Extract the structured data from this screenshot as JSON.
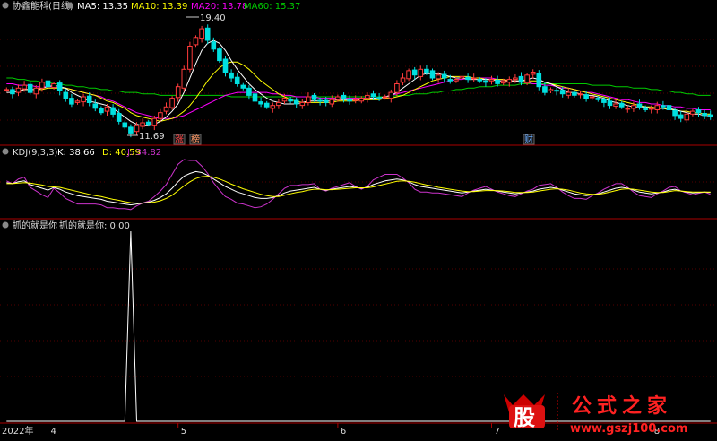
{
  "header": {
    "stock": "协鑫能科(日线)",
    "ma5_label": "MA5: 13.35",
    "ma10_label": "MA10: 13.39",
    "ma20_label": "MA20: 13.78",
    "ma60_label": "MA60: 15.37"
  },
  "kdj_header": {
    "title": "KDJ(9,3,3)",
    "k_label": "K: 38.66",
    "d_label": "D: 40.59",
    "j_label": "J: 34.82"
  },
  "ind_header": {
    "title": "抓的就是你",
    "value_label": "抓的就是你: 0.00"
  },
  "annotations": {
    "high": "19.40",
    "low": "11.69",
    "tag1": "涨",
    "tag2": "榜",
    "tag3": "财"
  },
  "xaxis": {
    "year": "2022年",
    "months": [
      "4",
      "5",
      "6",
      "7",
      "8"
    ]
  },
  "logo": {
    "char": "股",
    "text": "公式之家",
    "url": "www.gszj100.com"
  },
  "colors": {
    "up": "#ff3b3b",
    "down": "#00e0e0",
    "ma5": "#ffffff",
    "ma10": "#ffff00",
    "ma20": "#ff00ff",
    "ma60": "#00cc00",
    "k": "#ffffff",
    "d": "#ffff00",
    "j": "#cc33cc",
    "grid": "#aa0000"
  },
  "chart_data": [
    {
      "type": "candlestick",
      "title": "协鑫能科(日线)",
      "ylim": [
        11.2,
        20.0
      ],
      "high_marker": 19.4,
      "low_marker": 11.69,
      "closes": [
        14.8,
        14.5,
        14.9,
        15.1,
        14.6,
        14.9,
        15.3,
        15.0,
        15.2,
        14.7,
        14.2,
        13.8,
        14.0,
        14.3,
        13.9,
        13.5,
        13.2,
        13.6,
        13.1,
        12.6,
        12.2,
        11.8,
        12.3,
        12.5,
        12.4,
        12.8,
        13.2,
        13.6,
        14.2,
        15.0,
        16.2,
        17.8,
        18.4,
        19.0,
        18.2,
        17.6,
        16.8,
        16.0,
        15.6,
        15.2,
        14.9,
        14.4,
        14.0,
        13.8,
        13.6,
        13.7,
        13.9,
        14.2,
        14.0,
        13.8,
        13.9,
        14.3,
        14.1,
        14.0,
        13.9,
        14.1,
        14.3,
        14.2,
        14.0,
        14.1,
        14.2,
        14.4,
        14.3,
        14.2,
        14.3,
        14.6,
        15.2,
        15.6,
        16.1,
        15.8,
        16.2,
        16.0,
        15.6,
        15.8,
        15.6,
        15.4,
        15.5,
        15.7,
        15.5,
        15.6,
        15.4,
        15.3,
        15.5,
        15.2,
        15.4,
        15.5,
        15.6,
        15.3,
        15.8,
        16.0,
        15.0,
        14.6,
        14.8,
        14.7,
        14.5,
        14.6,
        14.4,
        14.5,
        14.2,
        14.3,
        14.1,
        13.9,
        13.7,
        13.8,
        13.6,
        13.5,
        13.7,
        13.6,
        13.4,
        13.5,
        13.7,
        13.6,
        13.4,
        13.0,
        12.8,
        13.1,
        13.3,
        13.2,
        13.0,
        12.9
      ],
      "ma5": [
        14.6,
        14.6,
        14.7,
        14.8,
        14.8,
        14.8,
        14.9,
        15.0,
        15.1,
        15.0,
        14.9,
        14.6,
        14.4,
        14.2,
        14.0,
        13.9,
        13.8,
        13.7,
        13.5,
        13.2,
        12.9,
        12.6,
        12.4,
        12.3,
        12.3,
        12.4,
        12.6,
        12.9,
        13.3,
        13.8,
        14.6,
        15.6,
        16.6,
        17.5,
        18.0,
        18.2,
        18.0,
        17.5,
        16.8,
        16.2,
        15.7,
        15.2,
        14.8,
        14.5,
        14.2,
        14.0,
        13.9,
        13.8,
        13.8,
        13.8,
        13.9,
        14.0,
        14.0,
        14.0,
        14.0,
        14.0,
        14.1,
        14.1,
        14.1,
        14.1,
        14.1,
        14.2,
        14.2,
        14.2,
        14.3,
        14.4,
        14.6,
        14.9,
        15.2,
        15.5,
        15.8,
        15.9,
        15.9,
        15.9,
        15.8,
        15.7,
        15.6,
        15.6,
        15.5,
        15.5,
        15.5,
        15.5,
        15.5,
        15.4,
        15.4,
        15.4,
        15.4,
        15.4,
        15.5,
        15.6,
        15.5,
        15.3,
        15.2,
        15.0,
        14.8,
        14.6,
        14.6,
        14.5,
        14.4,
        14.4,
        14.3,
        14.2,
        14.0,
        13.9,
        13.8,
        13.7,
        13.6,
        13.6,
        13.6,
        13.5,
        13.5,
        13.5,
        13.5,
        13.4,
        13.3,
        13.2,
        13.1,
        13.1,
        13.0,
        13.0
      ],
      "ma10": [
        14.7,
        14.7,
        14.7,
        14.8,
        14.8,
        14.8,
        14.8,
        14.9,
        14.9,
        14.9,
        14.9,
        14.8,
        14.7,
        14.6,
        14.5,
        14.4,
        14.2,
        14.0,
        13.9,
        13.7,
        13.5,
        13.2,
        13.0,
        12.9,
        12.8,
        12.7,
        12.6,
        12.7,
        12.8,
        13.0,
        13.3,
        13.7,
        14.2,
        14.8,
        15.4,
        15.9,
        16.3,
        16.6,
        16.7,
        16.7,
        16.5,
        16.2,
        15.8,
        15.4,
        15.1,
        14.8,
        14.5,
        14.3,
        14.1,
        14.0,
        13.9,
        13.9,
        13.9,
        13.9,
        13.9,
        13.9,
        14.0,
        14.0,
        14.0,
        14.0,
        14.1,
        14.1,
        14.1,
        14.1,
        14.2,
        14.2,
        14.3,
        14.4,
        14.6,
        14.8,
        15.0,
        15.2,
        15.4,
        15.5,
        15.6,
        15.7,
        15.7,
        15.7,
        15.7,
        15.6,
        15.6,
        15.5,
        15.5,
        15.5,
        15.5,
        15.4,
        15.4,
        15.4,
        15.4,
        15.4,
        15.4,
        15.3,
        15.2,
        15.1,
        15.0,
        14.9,
        14.8,
        14.7,
        14.6,
        14.5,
        14.4,
        14.3,
        14.2,
        14.1,
        14.0,
        13.9,
        13.8,
        13.7,
        13.6,
        13.6,
        13.5,
        13.5,
        13.4,
        13.4,
        13.3,
        13.3,
        13.2,
        13.2,
        13.1,
        13.1
      ],
      "ma20": [
        15.2,
        15.2,
        15.1,
        15.1,
        15.1,
        15.0,
        15.0,
        15.0,
        15.0,
        14.9,
        14.9,
        14.8,
        14.7,
        14.6,
        14.5,
        14.4,
        14.3,
        14.1,
        14.0,
        13.8,
        13.6,
        13.4,
        13.2,
        13.1,
        13.0,
        12.9,
        12.8,
        12.8,
        12.8,
        12.9,
        13.0,
        13.2,
        13.4,
        13.6,
        13.8,
        14.0,
        14.2,
        14.4,
        14.5,
        14.6,
        14.6,
        14.6,
        14.6,
        14.6,
        14.6,
        14.5,
        14.5,
        14.4,
        14.4,
        14.3,
        14.3,
        14.3,
        14.3,
        14.2,
        14.2,
        14.2,
        14.2,
        14.2,
        14.2,
        14.2,
        14.2,
        14.2,
        14.2,
        14.2,
        14.3,
        14.4,
        14.5,
        14.6,
        14.7,
        14.8,
        14.9,
        15.0,
        15.1,
        15.2,
        15.3,
        15.4,
        15.5,
        15.5,
        15.6,
        15.6,
        15.6,
        15.6,
        15.6,
        15.5,
        15.5,
        15.4,
        15.4,
        15.3,
        15.3,
        15.2,
        15.2,
        15.1,
        15.1,
        15.0,
        14.9,
        14.9,
        14.8,
        14.7,
        14.6,
        14.6,
        14.5,
        14.4,
        14.3,
        14.2,
        14.1,
        14.1,
        14.0,
        13.9,
        13.9,
        13.8,
        13.8,
        13.7,
        13.7,
        13.6,
        13.6,
        13.5,
        13.5,
        13.4,
        13.4,
        13.4
      ],
      "ma60": [
        15.6,
        15.6,
        15.5,
        15.5,
        15.4,
        15.4,
        15.3,
        15.3,
        15.2,
        15.2,
        15.1,
        15.1,
        15.0,
        15.0,
        14.9,
        14.9,
        14.8,
        14.8,
        14.7,
        14.7,
        14.6,
        14.6,
        14.6,
        14.5,
        14.5,
        14.5,
        14.4,
        14.4,
        14.4,
        14.4,
        14.4,
        14.4,
        14.4,
        14.4,
        14.4,
        14.4,
        14.4,
        14.4,
        14.3,
        14.3,
        14.3,
        14.3,
        14.3,
        14.3,
        14.3,
        14.3,
        14.3,
        14.3,
        14.3,
        14.3,
        14.3,
        14.3,
        14.3,
        14.3,
        14.3,
        14.3,
        14.3,
        14.3,
        14.3,
        14.3,
        14.3,
        14.3,
        14.3,
        14.3,
        14.3,
        14.3,
        14.4,
        14.4,
        14.4,
        14.5,
        14.5,
        14.5,
        14.6,
        14.6,
        14.7,
        14.7,
        14.8,
        14.8,
        14.9,
        14.9,
        15.0,
        15.0,
        15.0,
        15.1,
        15.1,
        15.1,
        15.1,
        15.2,
        15.2,
        15.2,
        15.2,
        15.2,
        15.2,
        15.2,
        15.2,
        15.2,
        15.2,
        15.2,
        15.2,
        15.1,
        15.1,
        15.1,
        15.1,
        15.0,
        15.0,
        15.0,
        14.9,
        14.9,
        14.9,
        14.8,
        14.8,
        14.7,
        14.7,
        14.6,
        14.6,
        14.5,
        14.5,
        14.4,
        14.4,
        14.4
      ]
    },
    {
      "type": "line",
      "title": "KDJ(9,3,3)",
      "ylim": [
        -10,
        110
      ],
      "series": [
        {
          "name": "K",
          "values": [
            60,
            58,
            62,
            64,
            56,
            52,
            48,
            44,
            50,
            46,
            40,
            36,
            32,
            30,
            28,
            26,
            24,
            20,
            18,
            16,
            14,
            12,
            14,
            16,
            18,
            22,
            28,
            36,
            48,
            62,
            74,
            80,
            84,
            82,
            76,
            68,
            60,
            52,
            46,
            40,
            36,
            32,
            28,
            26,
            26,
            28,
            32,
            38,
            42,
            44,
            46,
            48,
            50,
            46,
            44,
            46,
            48,
            50,
            52,
            50,
            48,
            50,
            56,
            60,
            64,
            66,
            68,
            66,
            62,
            56,
            52,
            50,
            48,
            46,
            44,
            42,
            40,
            38,
            40,
            42,
            44,
            46,
            44,
            42,
            40,
            38,
            36,
            38,
            40,
            42,
            46,
            48,
            50,
            48,
            44,
            40,
            36,
            34,
            32,
            34,
            36,
            40,
            44,
            48,
            50,
            48,
            44,
            40,
            38,
            36,
            38,
            40,
            44,
            46,
            42,
            40,
            38,
            39,
            40,
            39
          ]
        },
        {
          "name": "D",
          "values": [
            58,
            58,
            59,
            60,
            59,
            57,
            55,
            52,
            51,
            50,
            47,
            44,
            41,
            38,
            35,
            32,
            30,
            27,
            24,
            22,
            19,
            17,
            16,
            16,
            17,
            18,
            21,
            26,
            33,
            43,
            53,
            62,
            69,
            73,
            74,
            72,
            68,
            63,
            57,
            52,
            47,
            43,
            39,
            35,
            32,
            30,
            30,
            33,
            36,
            39,
            41,
            44,
            46,
            46,
            45,
            45,
            46,
            47,
            48,
            49,
            49,
            49,
            51,
            54,
            57,
            60,
            63,
            64,
            63,
            61,
            58,
            55,
            53,
            50,
            48,
            46,
            44,
            42,
            41,
            41,
            42,
            43,
            43,
            43,
            42,
            41,
            39,
            39,
            39,
            40,
            42,
            44,
            46,
            47,
            46,
            44,
            41,
            38,
            36,
            35,
            35,
            37,
            40,
            43,
            46,
            47,
            46,
            44,
            42,
            40,
            39,
            39,
            41,
            43,
            42,
            41,
            40,
            40,
            40,
            40
          ]
        },
        {
          "name": "J",
          "values": [
            64,
            58,
            68,
            72,
            50,
            42,
            34,
            28,
            48,
            38,
            26,
            20,
            14,
            14,
            14,
            14,
            12,
            6,
            6,
            4,
            4,
            2,
            10,
            16,
            20,
            30,
            42,
            56,
            78,
            100,
            110,
            108,
            108,
            96,
            80,
            60,
            44,
            30,
            24,
            16,
            14,
            10,
            6,
            8,
            14,
            24,
            36,
            48,
            54,
            54,
            56,
            56,
            58,
            46,
            42,
            48,
            52,
            56,
            60,
            52,
            46,
            52,
            66,
            72,
            78,
            78,
            78,
            70,
            60,
            46,
            40,
            40,
            38,
            38,
            36,
            34,
            32,
            30,
            38,
            44,
            48,
            52,
            46,
            40,
            36,
            32,
            30,
            36,
            42,
            46,
            54,
            56,
            58,
            50,
            40,
            32,
            26,
            26,
            24,
            32,
            38,
            46,
            52,
            58,
            58,
            50,
            40,
            32,
            30,
            28,
            36,
            42,
            50,
            52,
            42,
            38,
            34,
            37,
            40,
            35
          ]
        }
      ]
    },
    {
      "type": "line",
      "title": "抓的就是你",
      "ylim": [
        0,
        1
      ],
      "series": [
        {
          "name": "抓的就是你",
          "values": [
            0,
            0,
            0,
            0,
            0,
            0,
            0,
            0,
            0,
            0,
            0,
            0,
            0,
            0,
            0,
            0,
            0,
            0,
            0,
            0,
            0,
            0,
            0,
            0,
            0,
            0,
            0,
            0,
            0,
            0,
            0,
            0,
            0,
            0,
            0,
            0,
            0,
            0,
            0,
            0,
            0,
            0,
            0,
            0,
            0,
            0,
            0,
            0,
            0,
            0,
            0,
            0,
            0,
            0,
            0,
            0,
            0,
            0,
            0,
            0,
            0,
            0,
            0,
            0,
            0,
            0,
            0,
            0,
            0,
            0,
            0,
            0,
            0,
            0,
            0,
            0,
            0,
            0,
            0,
            0,
            0,
            0,
            0,
            0,
            0,
            0,
            0,
            0,
            0,
            0,
            0,
            0,
            0,
            0,
            0,
            0,
            0,
            0,
            0,
            0,
            0,
            0,
            0,
            0,
            0,
            0,
            0,
            0,
            0,
            0,
            0,
            0,
            0,
            0,
            0,
            0,
            0,
            0,
            0,
            0
          ]
        }
      ],
      "spike_index": 21,
      "spike_value": 1
    }
  ]
}
